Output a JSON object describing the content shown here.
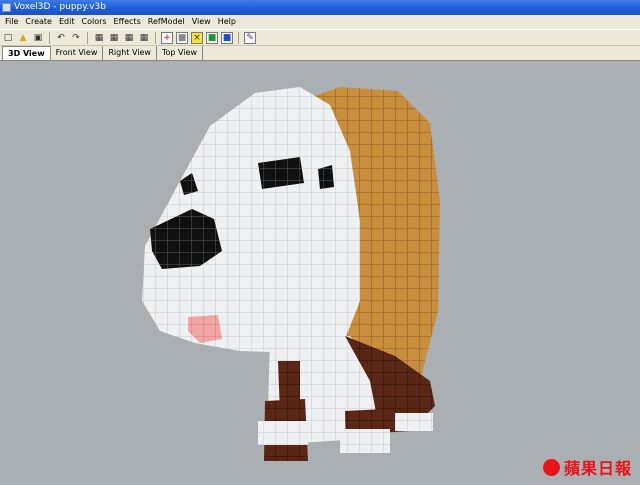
{
  "window": {
    "title": "Voxel3D - puppy.v3b"
  },
  "menu": [
    "File",
    "Create",
    "Edit",
    "Colors",
    "Effects",
    "RefModel",
    "View",
    "Help"
  ],
  "toolbar_icons": [
    "new-file-icon",
    "open-folder-icon",
    "save-icon",
    "undo-icon",
    "redo-icon",
    "grid-tool-icon",
    "grid-tool-icon",
    "grid-tool-icon",
    "grid-tool-icon",
    "add-voxel-icon",
    "select-tool-icon",
    "delete-voxel-icon",
    "paint-icon",
    "color-picker-icon",
    "pencil-tool-icon"
  ],
  "tabs": [
    "3D View",
    "Front View",
    "Right View",
    "Top View"
  ],
  "active_tab": "3D View",
  "watermark": {
    "text": "蘋果日報"
  },
  "colors": {
    "background": "#a9afb3",
    "white_voxel": "#eef0f1",
    "tan_voxel": "#c98f3f",
    "brown_voxel": "#5a2616",
    "black_voxel": "#101010",
    "pink_voxel": "#f0a6a4",
    "accent": "#e8141a"
  }
}
